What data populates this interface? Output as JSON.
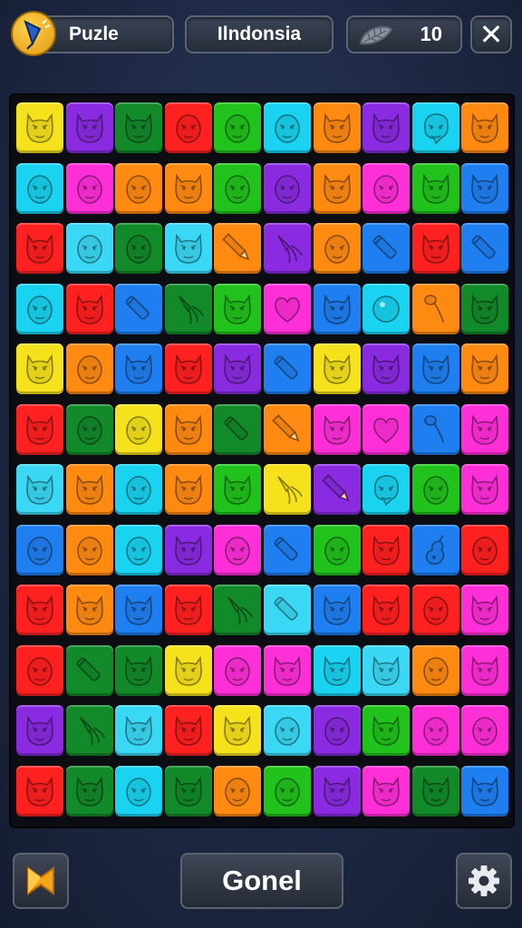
{
  "header": {
    "title": "Puzle",
    "region": "Ilndonsia",
    "score": "10",
    "close_symbol": "✕"
  },
  "footer": {
    "main_button_label": "Gonel",
    "left_icon": "bookmark-icon",
    "settings_icon": "gear-icon"
  },
  "palette": {
    "Y": "#f6e21c",
    "P": "#8a2be2",
    "C": "#19d3f0",
    "R": "#ff2020",
    "G": "#22c21d",
    "O": "#ff8a12",
    "M": "#ff2fd8",
    "D": "#138a2a",
    "B": "#1f7ff0",
    "L": "#3bd8f5"
  },
  "board": {
    "columns": 10,
    "rows": [
      [
        [
          "Y",
          "cat"
        ],
        [
          "P",
          "cat"
        ],
        [
          "D",
          "cat"
        ],
        [
          "R",
          "face"
        ],
        [
          "G",
          "face"
        ],
        [
          "C",
          "face"
        ],
        [
          "O",
          "cat"
        ],
        [
          "P",
          "cat"
        ],
        [
          "C",
          "blob"
        ],
        [
          "O",
          "cat"
        ]
      ],
      [
        [
          "C",
          "face"
        ],
        [
          "M",
          "face"
        ],
        [
          "O",
          "face"
        ],
        [
          "O",
          "cat"
        ],
        [
          "G",
          "face"
        ],
        [
          "P",
          "face"
        ],
        [
          "O",
          "cat"
        ],
        [
          "M",
          "face"
        ],
        [
          "G",
          "cat"
        ],
        [
          "B",
          "cat"
        ]
      ],
      [
        [
          "R",
          "cat"
        ],
        [
          "L",
          "face"
        ],
        [
          "D",
          "face"
        ],
        [
          "L",
          "cat"
        ],
        [
          "O",
          "pencil"
        ],
        [
          "P",
          "squid"
        ],
        [
          "O",
          "face"
        ],
        [
          "B",
          "crayon"
        ],
        [
          "R",
          "cat"
        ],
        [
          "B",
          "crayon"
        ]
      ],
      [
        [
          "C",
          "face"
        ],
        [
          "R",
          "cat"
        ],
        [
          "B",
          "crayon"
        ],
        [
          "D",
          "squid"
        ],
        [
          "G",
          "cat"
        ],
        [
          "M",
          "heart"
        ],
        [
          "B",
          "cat"
        ],
        [
          "C",
          "ball"
        ],
        [
          "O",
          "spoon"
        ],
        [
          "D",
          "cat"
        ]
      ],
      [
        [
          "Y",
          "cat"
        ],
        [
          "O",
          "face"
        ],
        [
          "B",
          "cat"
        ],
        [
          "R",
          "cat"
        ],
        [
          "P",
          "cat"
        ],
        [
          "B",
          "crayon"
        ],
        [
          "Y",
          "cat"
        ],
        [
          "P",
          "cat"
        ],
        [
          "B",
          "cat"
        ],
        [
          "O",
          "cat"
        ]
      ],
      [
        [
          "R",
          "cat"
        ],
        [
          "D",
          "face"
        ],
        [
          "Y",
          "face"
        ],
        [
          "O",
          "cat"
        ],
        [
          "D",
          "crayon"
        ],
        [
          "O",
          "pencil"
        ],
        [
          "M",
          "cat"
        ],
        [
          "M",
          "heart"
        ],
        [
          "B",
          "spoon"
        ],
        [
          "M",
          "cat"
        ]
      ],
      [
        [
          "L",
          "cat"
        ],
        [
          "O",
          "cat"
        ],
        [
          "C",
          "face"
        ],
        [
          "O",
          "cat"
        ],
        [
          "G",
          "cat"
        ],
        [
          "Y",
          "squid"
        ],
        [
          "P",
          "pencil"
        ],
        [
          "C",
          "blob"
        ],
        [
          "G",
          "face"
        ],
        [
          "M",
          "cat"
        ]
      ],
      [
        [
          "B",
          "face"
        ],
        [
          "O",
          "face"
        ],
        [
          "C",
          "face"
        ],
        [
          "P",
          "cat"
        ],
        [
          "M",
          "face"
        ],
        [
          "B",
          "crayon"
        ],
        [
          "G",
          "face"
        ],
        [
          "R",
          "cat"
        ],
        [
          "B",
          "gourd"
        ],
        [
          "R",
          "face"
        ]
      ],
      [
        [
          "R",
          "cat"
        ],
        [
          "O",
          "cat"
        ],
        [
          "B",
          "cat"
        ],
        [
          "R",
          "cat"
        ],
        [
          "D",
          "squid"
        ],
        [
          "L",
          "crayon"
        ],
        [
          "B",
          "cat"
        ],
        [
          "R",
          "cat"
        ],
        [
          "R",
          "face"
        ],
        [
          "M",
          "cat"
        ]
      ],
      [
        [
          "R",
          "face"
        ],
        [
          "D",
          "crayon"
        ],
        [
          "D",
          "cat"
        ],
        [
          "Y",
          "cat"
        ],
        [
          "M",
          "face"
        ],
        [
          "M",
          "cat"
        ],
        [
          "C",
          "cat"
        ],
        [
          "L",
          "cat"
        ],
        [
          "O",
          "face"
        ],
        [
          "M",
          "cat"
        ]
      ],
      [
        [
          "P",
          "cat"
        ],
        [
          "D",
          "squid"
        ],
        [
          "L",
          "cat"
        ],
        [
          "R",
          "cat"
        ],
        [
          "Y",
          "cat"
        ],
        [
          "L",
          "face"
        ],
        [
          "P",
          "face"
        ],
        [
          "G",
          "cat"
        ],
        [
          "M",
          "face"
        ],
        [
          "M",
          "face"
        ]
      ],
      [
        [
          "R",
          "cat"
        ],
        [
          "D",
          "cat"
        ],
        [
          "C",
          "face"
        ],
        [
          "D",
          "cat"
        ],
        [
          "O",
          "face"
        ],
        [
          "G",
          "face"
        ],
        [
          "P",
          "cat"
        ],
        [
          "M",
          "cat"
        ],
        [
          "D",
          "cat"
        ],
        [
          "B",
          "cat"
        ]
      ]
    ]
  }
}
